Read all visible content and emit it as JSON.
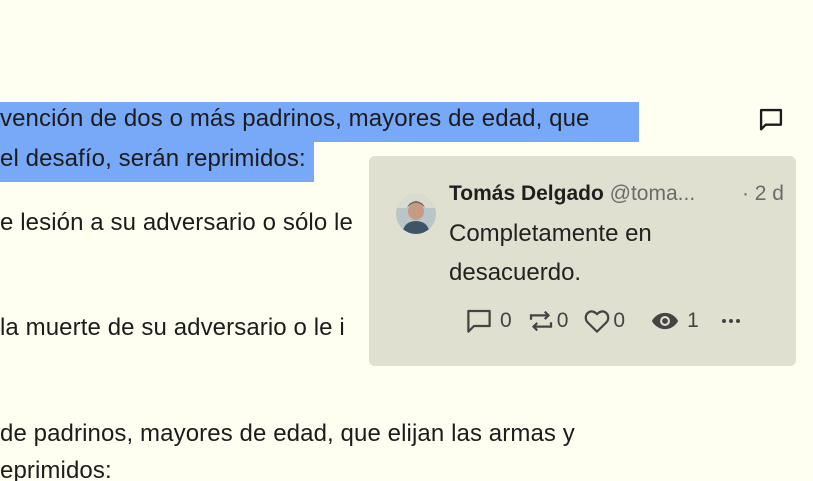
{
  "document": {
    "lines": [
      "vención de dos o más padrinos, mayores de edad, que",
      "el desafío, serán reprimidos",
      ":",
      "e lesión a su adversario o sólo le",
      "la muerte de su adversario o le i",
      " de padrinos, mayores de edad, que elijan las armas y",
      "eprimidos:"
    ]
  },
  "toolbar": {
    "comment_icon": "comment-icon"
  },
  "comment": {
    "author": "Tomás Delgado",
    "handle": "@toma...",
    "time": "· 2 d",
    "text": "Completamente en desacuerdo.",
    "stats": {
      "replies": "0",
      "reposts": "0",
      "likes": "0",
      "views": "1"
    }
  },
  "colors": {
    "background": "#fefff0",
    "highlight": "#78a8f8",
    "card": "#e0e0d0"
  }
}
